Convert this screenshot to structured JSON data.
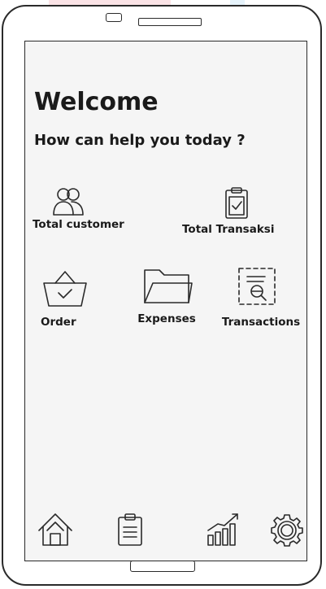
{
  "header": {
    "title": "Welcome",
    "subtitle": "How can help you today ?"
  },
  "stats": [
    {
      "label": "Total customer",
      "icon": "users-icon"
    },
    {
      "label": "Total Transaksi",
      "icon": "clipboard-check-icon"
    }
  ],
  "menu": [
    {
      "label": "Order",
      "icon": "basket-icon"
    },
    {
      "label": "Expenses",
      "icon": "folder-icon"
    },
    {
      "label": "Transactions",
      "icon": "document-search-icon"
    }
  ],
  "bottom_nav": [
    {
      "icon": "home-icon"
    },
    {
      "icon": "clipboard-list-icon"
    },
    {
      "icon": "chart-icon"
    },
    {
      "icon": "gear-icon"
    }
  ]
}
